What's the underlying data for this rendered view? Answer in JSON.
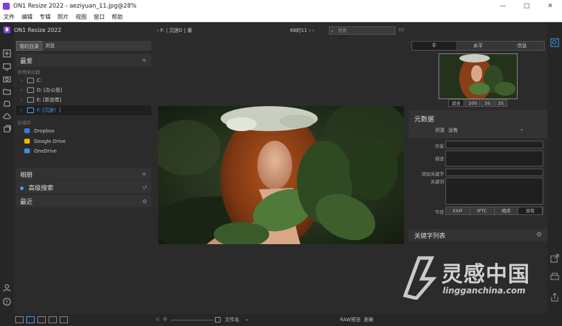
{
  "window": {
    "title": "ON1 Resize 2022 - aeziyuan_11.jpg@28%",
    "controls": {
      "minimize": "—",
      "maximize": "□",
      "close": "✕"
    }
  },
  "menu": [
    "文件",
    "编辑",
    "专辑",
    "照片",
    "视图",
    "窗口",
    "帮助"
  ],
  "left_panel": {
    "app_name": "ON1 Resize 2022",
    "tabs": [
      "我的目录",
      "浏览"
    ],
    "favorites": {
      "label": "最爱",
      "add": "+"
    },
    "local_drives_label": "本地驱动器",
    "drives": [
      {
        "label": "C:",
        "selected": false
      },
      {
        "label": "D: [办公盘]",
        "selected": false
      },
      {
        "label": "E: [新加卷]",
        "selected": false
      },
      {
        "label": "F: [沉迷！]",
        "selected": true
      }
    ],
    "cloud_label": "云储存",
    "cloud": [
      {
        "label": "Dropbox",
        "color": "#2f7de1"
      },
      {
        "label": "Google Drive",
        "color": "#f4b400"
      },
      {
        "label": "OneDrive",
        "color": "#3a8ee6"
      }
    ],
    "albums": {
      "label": "相册",
      "add": "+"
    },
    "advanced_search": {
      "label": "高级搜索"
    },
    "recent": {
      "label": "最近"
    }
  },
  "center": {
    "breadcrumb": "F: | 沉迷D | 書",
    "counter": "68的11",
    "search_placeholder": "搜索"
  },
  "right_panel": {
    "tabs": [
      "不",
      "水平",
      "信息"
    ],
    "active_tab": 0,
    "zoom_options": [
      "适合",
      "100",
      "50",
      "25"
    ],
    "zoom_selected": 0,
    "metadata": {
      "title": "元数据",
      "preset_label": "预置",
      "preset_value": "没有"
    },
    "fields": {
      "author": "作家",
      "description": "描述",
      "add_keyword": "添加关键字",
      "keywords": "关键词",
      "section": "节目"
    },
    "section_tabs": [
      "EXIF",
      "IPTC",
      "地点",
      "没有"
    ],
    "section_selected": 3,
    "keyword_list": {
      "label": "关键字列表"
    }
  },
  "bottom_bar": {
    "sort_label": "文件名",
    "raw_preview_label": "RAW预览",
    "raw_preview_value": "准确"
  },
  "watermark": {
    "cn": "灵感中国",
    "en": "lingganchina.com"
  },
  "colors": {
    "accent": "#4aa3ff",
    "app_logo": "#7b3fe4"
  }
}
